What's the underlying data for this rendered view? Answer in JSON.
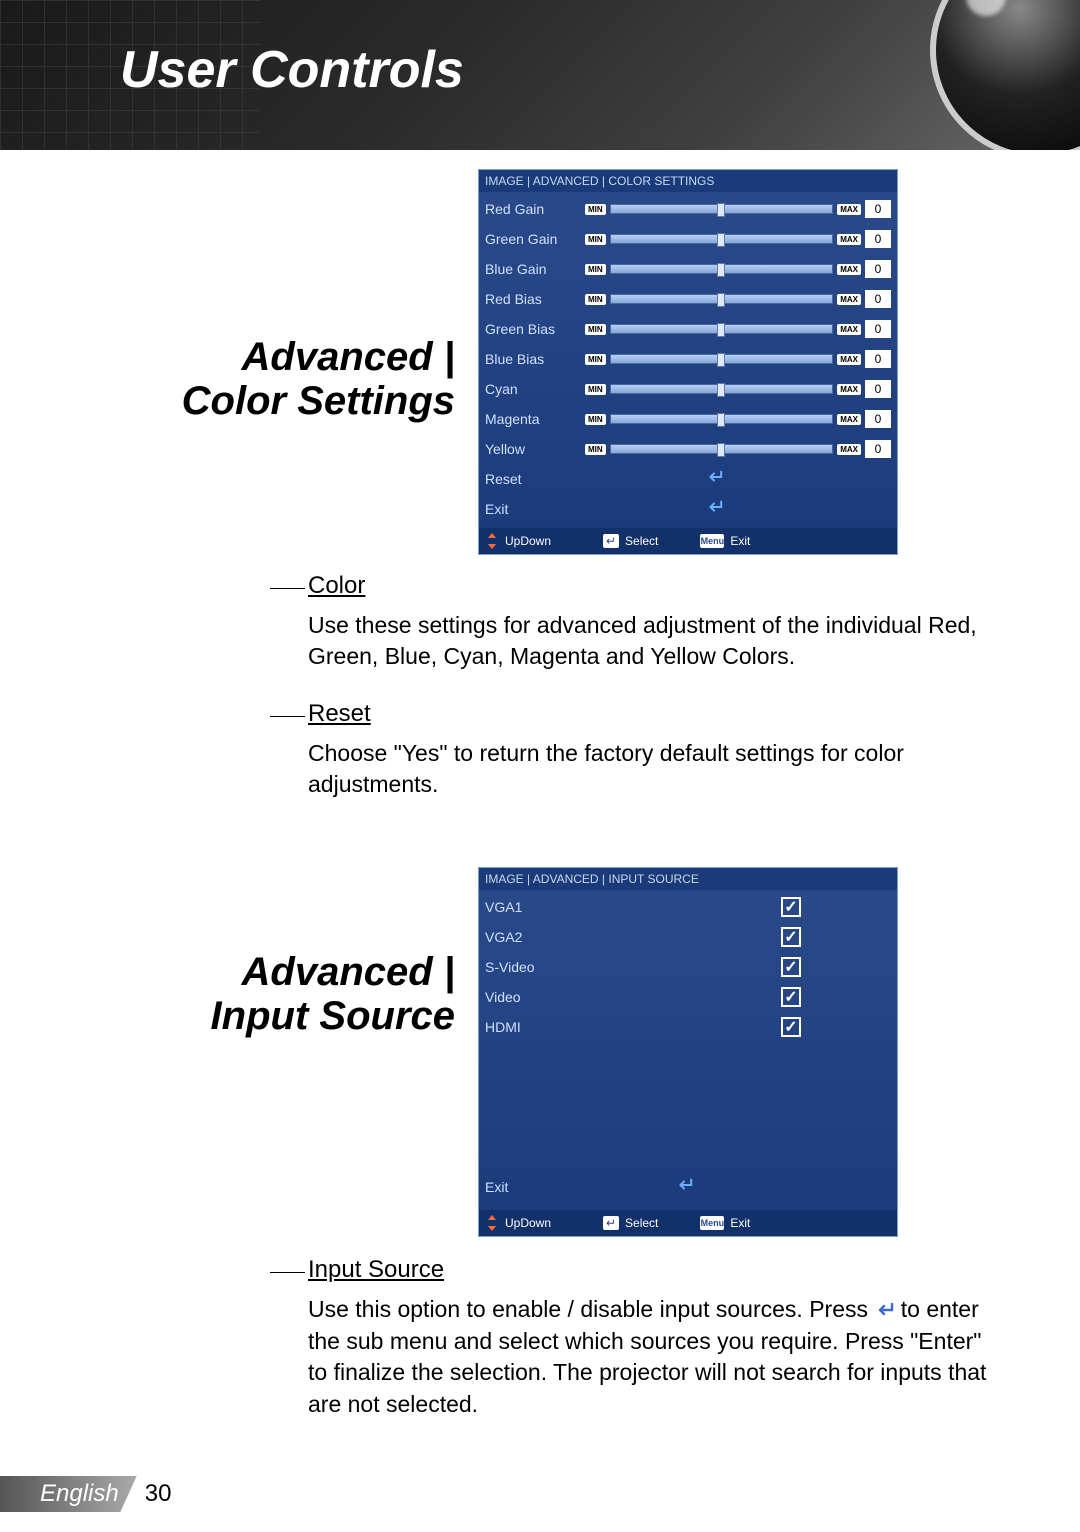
{
  "header": {
    "title": "User Controls"
  },
  "section1": {
    "label_line1": "Advanced |",
    "label_line2": "Color Settings"
  },
  "section2": {
    "label_line1": "Advanced |",
    "label_line2": "Input Source"
  },
  "osd1": {
    "title": "IMAGE | ADVANCED | COLOR SETTINGS",
    "rows": [
      {
        "label": "Red Gain",
        "min": "MIN",
        "max": "MAX",
        "value": "0"
      },
      {
        "label": "Green Gain",
        "min": "MIN",
        "max": "MAX",
        "value": "0"
      },
      {
        "label": "Blue Gain",
        "min": "MIN",
        "max": "MAX",
        "value": "0"
      },
      {
        "label": "Red Bias",
        "min": "MIN",
        "max": "MAX",
        "value": "0"
      },
      {
        "label": "Green Bias",
        "min": "MIN",
        "max": "MAX",
        "value": "0"
      },
      {
        "label": "Blue Bias",
        "min": "MIN",
        "max": "MAX",
        "value": "0"
      },
      {
        "label": "Cyan",
        "min": "MIN",
        "max": "MAX",
        "value": "0"
      },
      {
        "label": "Magenta",
        "min": "MIN",
        "max": "MAX",
        "value": "0"
      },
      {
        "label": "Yellow",
        "min": "MIN",
        "max": "MAX",
        "value": "0"
      }
    ],
    "reset": "Reset",
    "exit": "Exit",
    "footer": {
      "updown": "UpDown",
      "select": "Select",
      "menu": "Menu",
      "exit": "Exit"
    }
  },
  "osd2": {
    "title": "IMAGE | ADVANCED | INPUT SOURCE",
    "items": [
      {
        "label": "VGA1",
        "checked": true
      },
      {
        "label": "VGA2",
        "checked": true
      },
      {
        "label": "S-Video",
        "checked": true
      },
      {
        "label": "Video",
        "checked": true
      },
      {
        "label": "HDMI",
        "checked": true
      }
    ],
    "exit": "Exit",
    "footer": {
      "updown": "UpDown",
      "select": "Select",
      "menu": "Menu",
      "exit": "Exit"
    }
  },
  "doc": {
    "color_head": "Color",
    "color_body": "Use these settings for advanced adjustment of the individual Red, Green, Blue, Cyan, Magenta and Yellow Colors.",
    "reset_head": "Reset",
    "reset_body": "Choose \"Yes\" to return the factory default settings for color adjustments.",
    "input_head": "Input Source",
    "input_body_1": "Use this option to enable / disable input sources. Press ",
    "input_body_2": " to enter the sub menu and select which sources you require. Press \"Enter\" to finalize the selection. The projector will not search for inputs that are not selected."
  },
  "footer": {
    "lang": "English",
    "page": "30"
  }
}
